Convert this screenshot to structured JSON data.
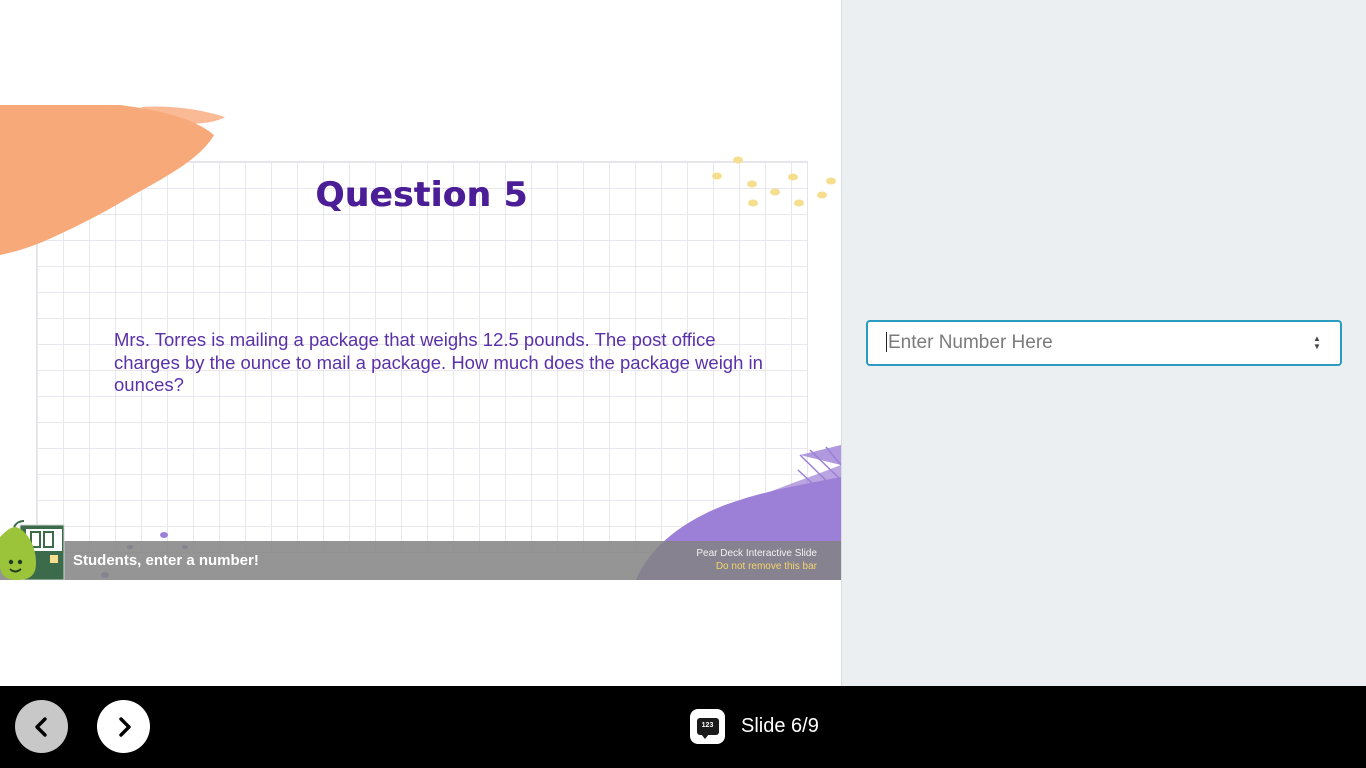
{
  "slide": {
    "title": "Question 5",
    "question": "Mrs. Torres is mailing a package that weighs 12.5 pounds.  The post office charges by the ounce to mail a package.  How much does the package weigh in ounces?",
    "student_prompt": "Students, enter a number!",
    "badge_line1": "Pear Deck Interactive Slide",
    "badge_line2": "Do not remove this bar",
    "colors": {
      "title": "#4b1d96",
      "text": "#5a31a8",
      "orange_brush": "#f7a97a",
      "purple_brush": "#9c7fd6",
      "yellow_dots": "#f5df8e"
    }
  },
  "response": {
    "input_placeholder": "Enter Number Here",
    "input_value": "",
    "accent_color": "#2a9cc0"
  },
  "nav": {
    "prev_icon": "chevron-left-icon",
    "next_icon": "chevron-right-icon",
    "slide_type_icon_label": "123",
    "slide_counter": "Slide 6/9"
  }
}
